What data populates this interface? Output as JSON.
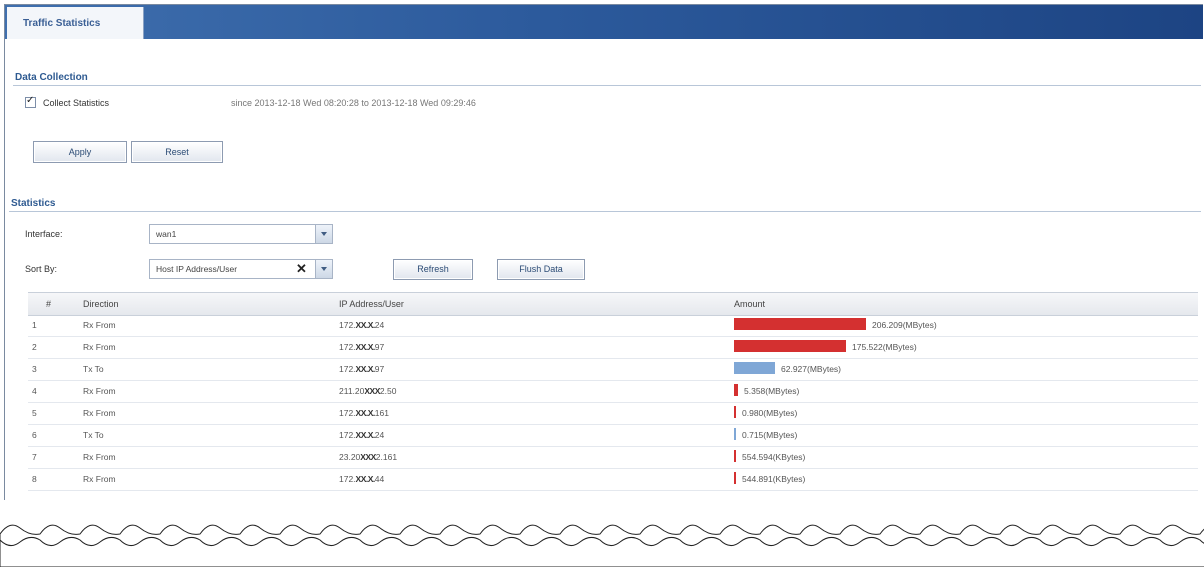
{
  "tab": {
    "label": "Traffic Statistics"
  },
  "data_collection": {
    "title": "Data Collection",
    "checkbox_label": "Collect Statistics",
    "since_text": "since 2013-12-18 Wed 08:20:28 to 2013-12-18 Wed 09:29:46",
    "apply_label": "Apply",
    "reset_label": "Reset"
  },
  "statistics": {
    "title": "Statistics",
    "interface_label": "Interface:",
    "interface_value": "wan1",
    "sort_label": "Sort By:",
    "sort_value": "Host IP Address/User",
    "refresh_label": "Refresh",
    "flush_label": "Flush Data"
  },
  "table": {
    "headers": [
      "#",
      "Direction",
      "IP Address/User",
      "Amount"
    ],
    "rows": [
      {
        "num": "1",
        "direction": "Rx From",
        "ip_prefix": "172.",
        "ip_mask": "XX.X.",
        "ip_suffix": "24",
        "amount": "206.209(MBytes)",
        "bar_fraction": 1.0,
        "bar_color": "#d43030"
      },
      {
        "num": "2",
        "direction": "Rx From",
        "ip_prefix": "172.",
        "ip_mask": "XX.X.",
        "ip_suffix": "97",
        "amount": "175.522(MBytes)",
        "bar_fraction": 0.85,
        "bar_color": "#d43030"
      },
      {
        "num": "3",
        "direction": "Tx To",
        "ip_prefix": "172.",
        "ip_mask": "XX.X.",
        "ip_suffix": "97",
        "amount": "62.927(MBytes)",
        "bar_fraction": 0.31,
        "bar_color": "#7fa7d6"
      },
      {
        "num": "4",
        "direction": "Rx From",
        "ip_prefix": "211.20",
        "ip_mask": "XXX",
        "ip_suffix": "2.50",
        "amount": "5.358(MBytes)",
        "bar_fraction": 0.03,
        "bar_color": "#d43030"
      },
      {
        "num": "5",
        "direction": "Rx From",
        "ip_prefix": "172.",
        "ip_mask": "XX.X.",
        "ip_suffix": "161",
        "amount": "0.980(MBytes)",
        "bar_fraction": 0.01,
        "bar_color": "#d43030"
      },
      {
        "num": "6",
        "direction": "Tx To",
        "ip_prefix": "172.",
        "ip_mask": "XX.X.",
        "ip_suffix": "24",
        "amount": "0.715(MBytes)",
        "bar_fraction": 0.008,
        "bar_color": "#7fa7d6"
      },
      {
        "num": "7",
        "direction": "Rx From",
        "ip_prefix": "23.20",
        "ip_mask": "XXX",
        "ip_suffix": "2.161",
        "amount": "554.594(KBytes)",
        "bar_fraction": 0.006,
        "bar_color": "#d43030"
      },
      {
        "num": "8",
        "direction": "Rx From",
        "ip_prefix": "172.",
        "ip_mask": "XX.X.",
        "ip_suffix": "44",
        "amount": "544.891(KBytes)",
        "bar_fraction": 0.006,
        "bar_color": "#d43030"
      }
    ]
  }
}
